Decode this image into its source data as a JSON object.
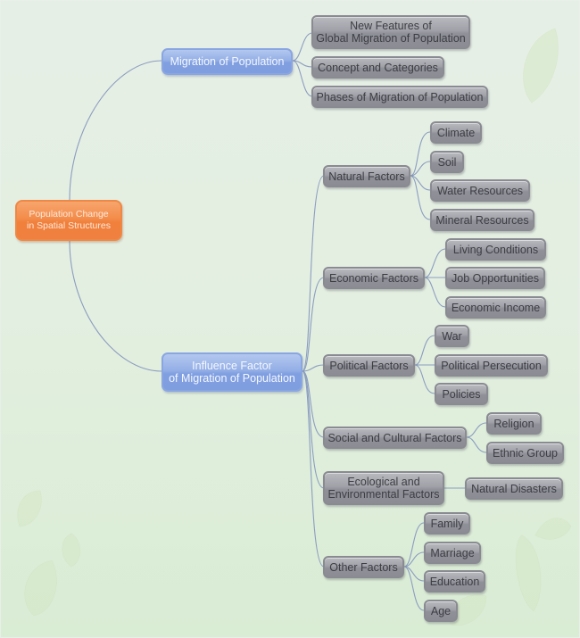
{
  "colors": {
    "root": "#f0803b",
    "level1": "#809fe0",
    "level2": "#8f9098",
    "connector": "#8b9dc0",
    "background": "#e3efe0"
  },
  "root": {
    "label": "Population Change\nin Spatial Structures",
    "line1": "Population Change",
    "line2": "in Spatial Structures"
  },
  "branches": [
    {
      "label": "Migration of Population",
      "children": [
        {
          "line1": "New Features of",
          "line2": "Global Migration of Population"
        },
        {
          "label": "Concept and Categories"
        },
        {
          "label": "Phases of Migration of Population"
        }
      ]
    },
    {
      "line1": "Influence Factor",
      "line2": "of Migration of Population",
      "children": [
        {
          "label": "Natural Factors",
          "children": [
            "Climate",
            "Soil",
            "Water Resources",
            "Mineral Resources"
          ]
        },
        {
          "label": "Economic Factors",
          "children": [
            "Living Conditions",
            "Job Opportunities",
            "Economic Income"
          ]
        },
        {
          "label": "Political Factors",
          "children": [
            "War",
            "Political Persecution",
            "Policies"
          ]
        },
        {
          "label": "Social and Cultural Factors",
          "children": [
            "Religion",
            "Ethnic Group"
          ]
        },
        {
          "line1": "Ecological and",
          "line2": "Environmental Factors",
          "children": [
            "Natural Disasters"
          ]
        },
        {
          "label": "Other Factors",
          "children": [
            "Family",
            "Marriage",
            "Education",
            "Age"
          ]
        }
      ]
    }
  ]
}
